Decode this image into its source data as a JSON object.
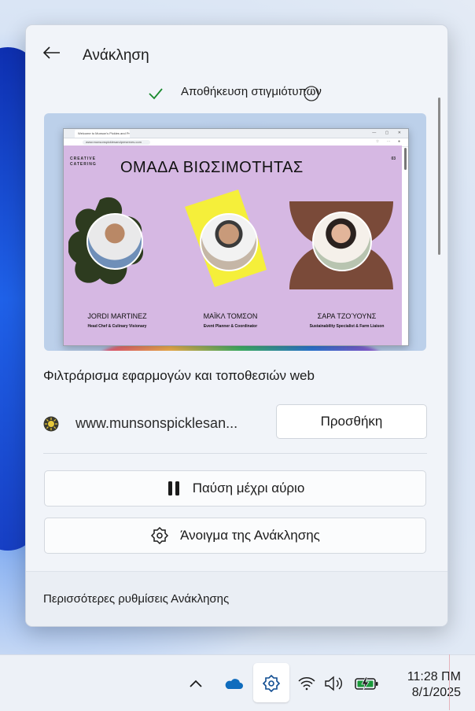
{
  "panel": {
    "title": "Ανάκληση",
    "status": "Αποθήκευση στιγμιότυπων",
    "status_color": "#1a8a2e"
  },
  "preview": {
    "browser_tab": "Welcome to Munson's Pickles and Preserves",
    "address": "www.munsonspicklesandpreserves.com",
    "brand_line1": "CREATIVE",
    "brand_line2": "CATERING",
    "page_number": "03",
    "heading": "ΟΜΑΔΑ ΒΙΩΣΙΜΟΤΗΤΑΣ",
    "members": [
      {
        "name": "JORDI MARTINEZ",
        "role": "Head Chef & Culinary Visionary"
      },
      {
        "name": "ΜΑΪΚΛ ΤΟΜΣΟΝ",
        "role": "Event Planner & Coordinator"
      },
      {
        "name": "ΣΑΡΑ ΤΖΟΎΟΥΝΣ",
        "role": "Sustainability Specialist & Farm Liaison"
      }
    ],
    "page_bg": "#d6b8e3"
  },
  "filter": {
    "title": "Φιλτράρισμα εφαρμογών και τοποθεσιών web",
    "site": "www.munsonspicklesan...",
    "add_label": "Προσθήκη"
  },
  "actions": {
    "pause_label": "Παύση μέχρι αύριο",
    "open_label": "Άνοιγμα της Ανάκλησης"
  },
  "footer": {
    "more_settings": "Περισσότερες ρυθμίσεις Ανάκλησης"
  },
  "taskbar": {
    "time": "11:28 ΠΜ",
    "date": "8/1/2025",
    "icons": [
      "chevron-up-icon",
      "onedrive-icon",
      "recall-icon",
      "wifi-icon",
      "volume-icon",
      "battery-charging-icon"
    ],
    "accent": "#0f6cbd"
  }
}
